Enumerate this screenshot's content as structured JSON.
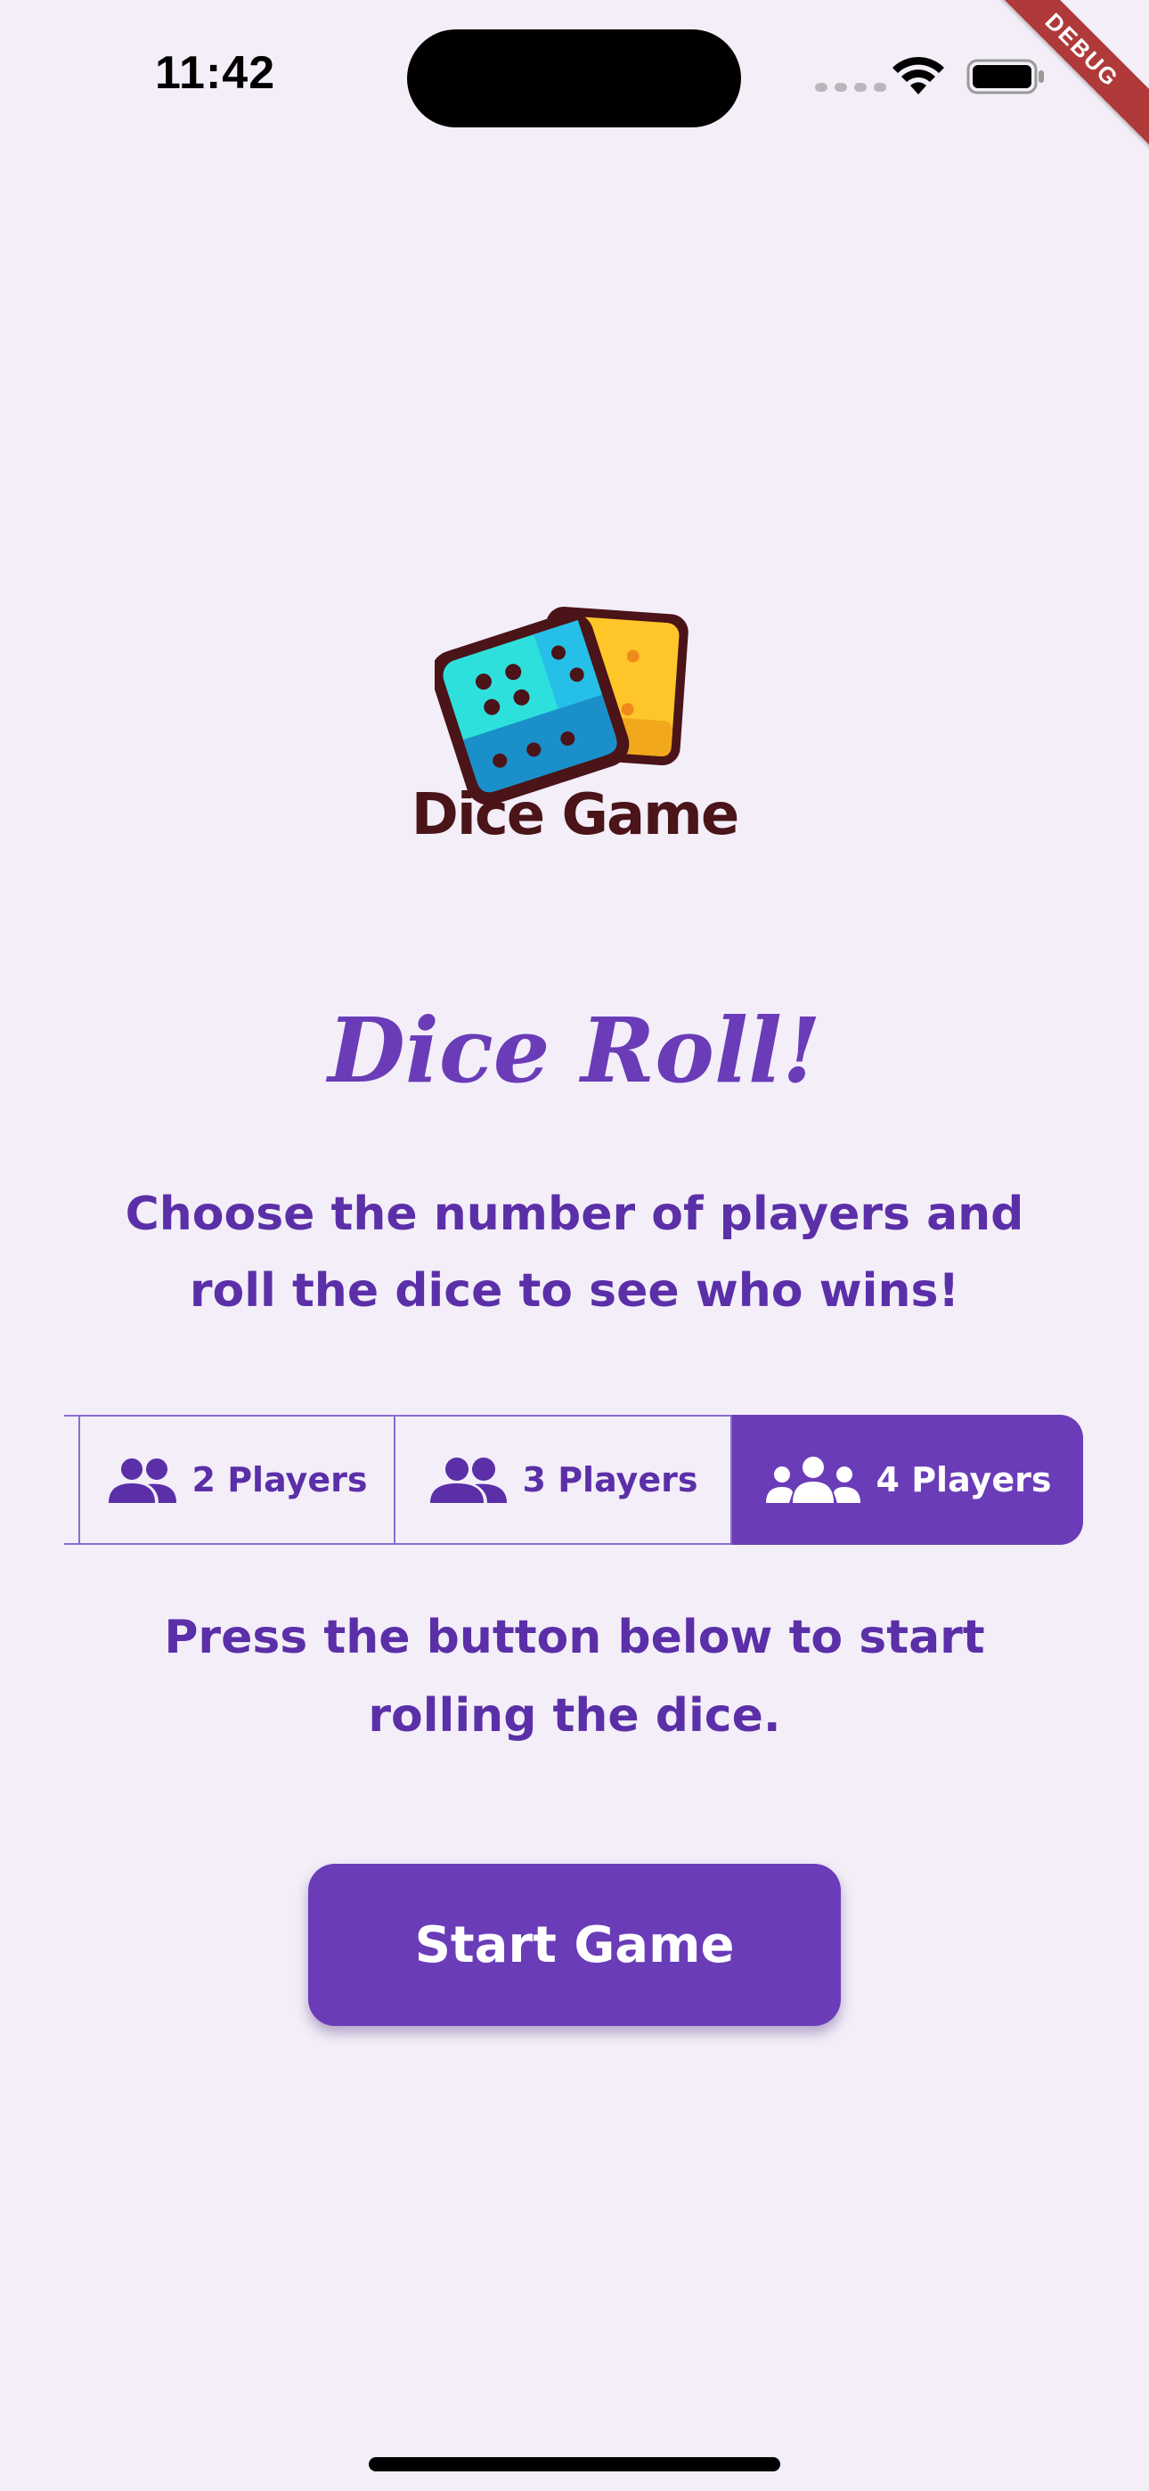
{
  "status_bar": {
    "time": "11:42",
    "debug_label": "DEBUG"
  },
  "logo": {
    "text": "Dice Game"
  },
  "headline": "Dice Roll!",
  "subtitle": "Choose the number of players and roll the dice to see who wins!",
  "player_options": [
    {
      "label": "2 Players",
      "icon": "group-icon",
      "selected": false
    },
    {
      "label": "3 Players",
      "icon": "group-icon",
      "selected": false
    },
    {
      "label": "4 Players",
      "icon": "groups-icon",
      "selected": true
    }
  ],
  "instructions": "Press the button below to start rolling the dice.",
  "start_button": {
    "label": "Start Game"
  },
  "colors": {
    "background": "#f3eef8",
    "accent": "#6a3cb8",
    "text": "#5b2fa8",
    "logo_text": "#4a1418"
  }
}
